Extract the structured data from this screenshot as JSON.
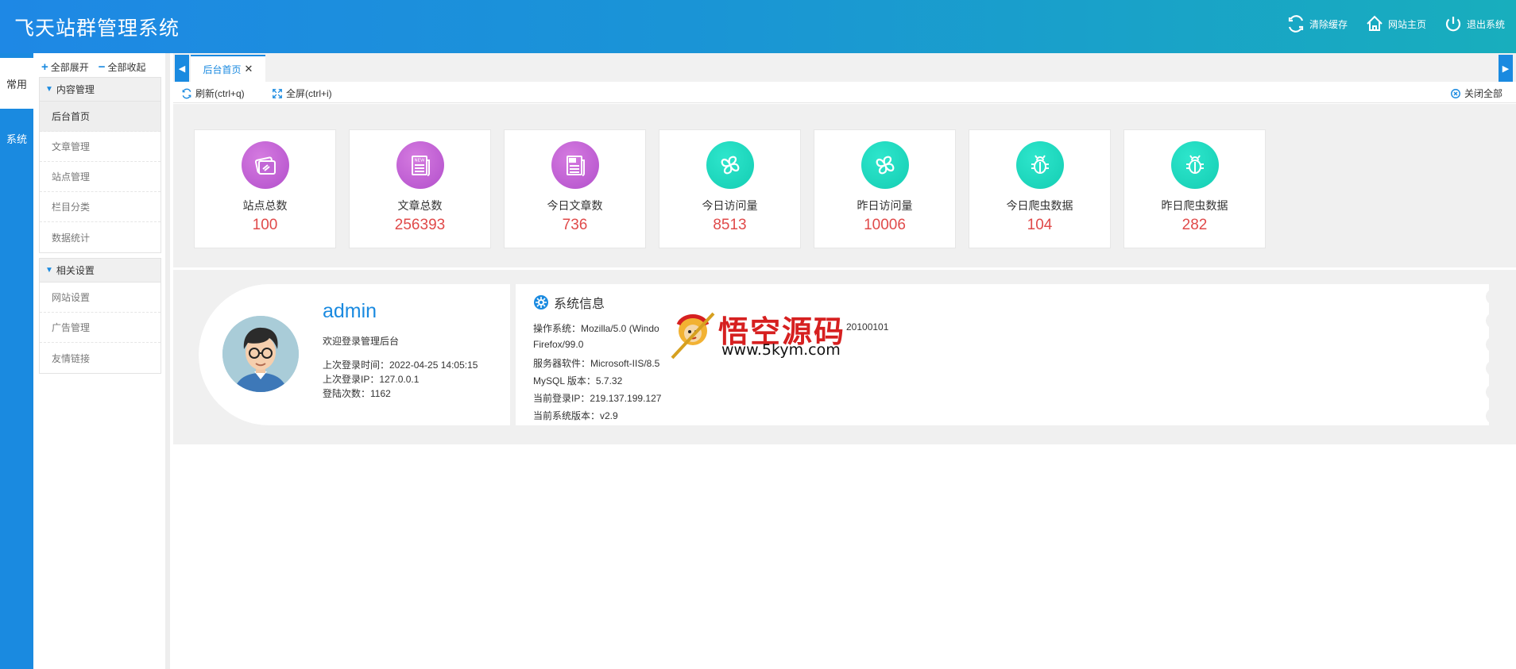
{
  "header": {
    "title": "飞天站群管理系统",
    "actions": [
      {
        "label": "清除缓存",
        "icon": "refresh-icon"
      },
      {
        "label": "网站主页",
        "icon": "home-icon"
      },
      {
        "label": "退出系统",
        "icon": "power-icon"
      }
    ]
  },
  "rail": {
    "items": [
      {
        "label": "常用",
        "active": true
      },
      {
        "label": "系统",
        "active": false
      }
    ]
  },
  "sidebar": {
    "expand_all": "全部展开",
    "collapse_all": "全部收起",
    "groups": [
      {
        "title": "内容管理",
        "items": [
          "后台首页",
          "文章管理",
          "站点管理",
          "栏目分类",
          "数据统计"
        ],
        "active_index": 0
      },
      {
        "title": "相关设置",
        "items": [
          "网站设置",
          "广告管理",
          "友情链接"
        ]
      }
    ]
  },
  "tabs": {
    "active_tab": "后台首页",
    "close_symbol": "✕",
    "refresh": "刷新(ctrl+q)",
    "fullscreen": "全屏(ctrl+i)",
    "close_all": "关闭全部"
  },
  "stats": [
    {
      "label": "站点总数",
      "value": "100",
      "icon": "card-icon",
      "color": "purple"
    },
    {
      "label": "文章总数",
      "value": "256393",
      "icon": "news-icon",
      "color": "purple"
    },
    {
      "label": "今日文章数",
      "value": "736",
      "icon": "today-doc-icon",
      "color": "purple"
    },
    {
      "label": "今日访问量",
      "value": "8513",
      "icon": "clover-icon",
      "color": "teal"
    },
    {
      "label": "昨日访问量",
      "value": "10006",
      "icon": "clover-icon",
      "color": "teal"
    },
    {
      "label": "今日爬虫数据",
      "value": "104",
      "icon": "bug-icon",
      "color": "teal"
    },
    {
      "label": "昨日爬虫数据",
      "value": "282",
      "icon": "bug-icon",
      "color": "teal"
    }
  ],
  "profile": {
    "username": "admin",
    "welcome": "欢迎登录管理后台",
    "last_login_time": "上次登录时间：2022-04-25 14:05:15",
    "last_login_ip": "上次登录IP：127.0.0.1",
    "login_count": "登陆次数：1162"
  },
  "system_info": {
    "title": "系统信息",
    "os": "操作系统：Mozilla/5.0 (Windo",
    "os_tail": "20100101",
    "browser": "Firefox/99.0",
    "server": "服务器软件：Microsoft-IIS/8.5",
    "mysql": "MySQL 版本：5.7.32",
    "ip": "当前登录IP：219.137.199.127",
    "version": "当前系统版本：v2.9"
  },
  "watermark": {
    "title": "悟空源码",
    "url": "www.5kym.com"
  },
  "colors": {
    "accent": "#1a8ae0",
    "value_red": "#e04a4a",
    "purple": "#b24fcb",
    "teal": "#14cdb3"
  }
}
